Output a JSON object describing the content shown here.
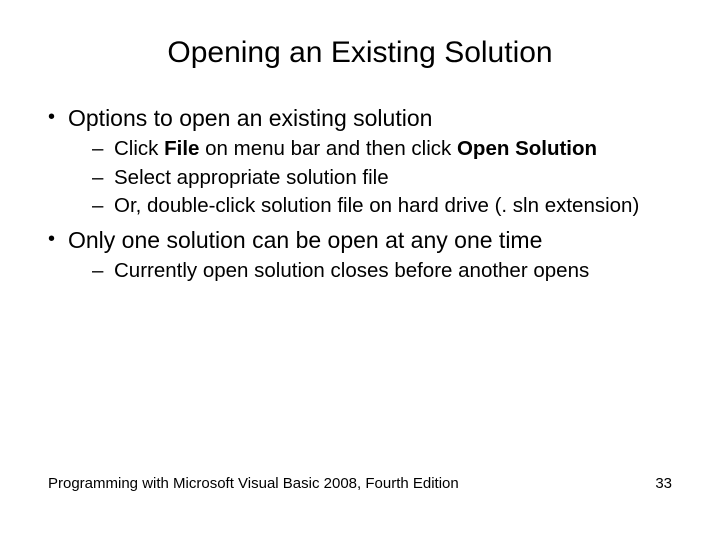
{
  "title": "Opening an Existing Solution",
  "bullets": [
    {
      "text": "Options to open an existing solution",
      "sub": [
        {
          "pre": "Click ",
          "b1": "File",
          "mid": " on menu bar and then click ",
          "b2": "Open Solution"
        },
        {
          "text": "Select appropriate solution file"
        },
        {
          "text": "Or, double-click solution file on hard drive (. sln extension)"
        }
      ]
    },
    {
      "text": "Only one solution can be open at any one time",
      "sub": [
        {
          "text": "Currently open solution closes before another opens"
        }
      ]
    }
  ],
  "footer": {
    "left": "Programming with Microsoft Visual Basic 2008, Fourth Edition",
    "right": "33"
  }
}
